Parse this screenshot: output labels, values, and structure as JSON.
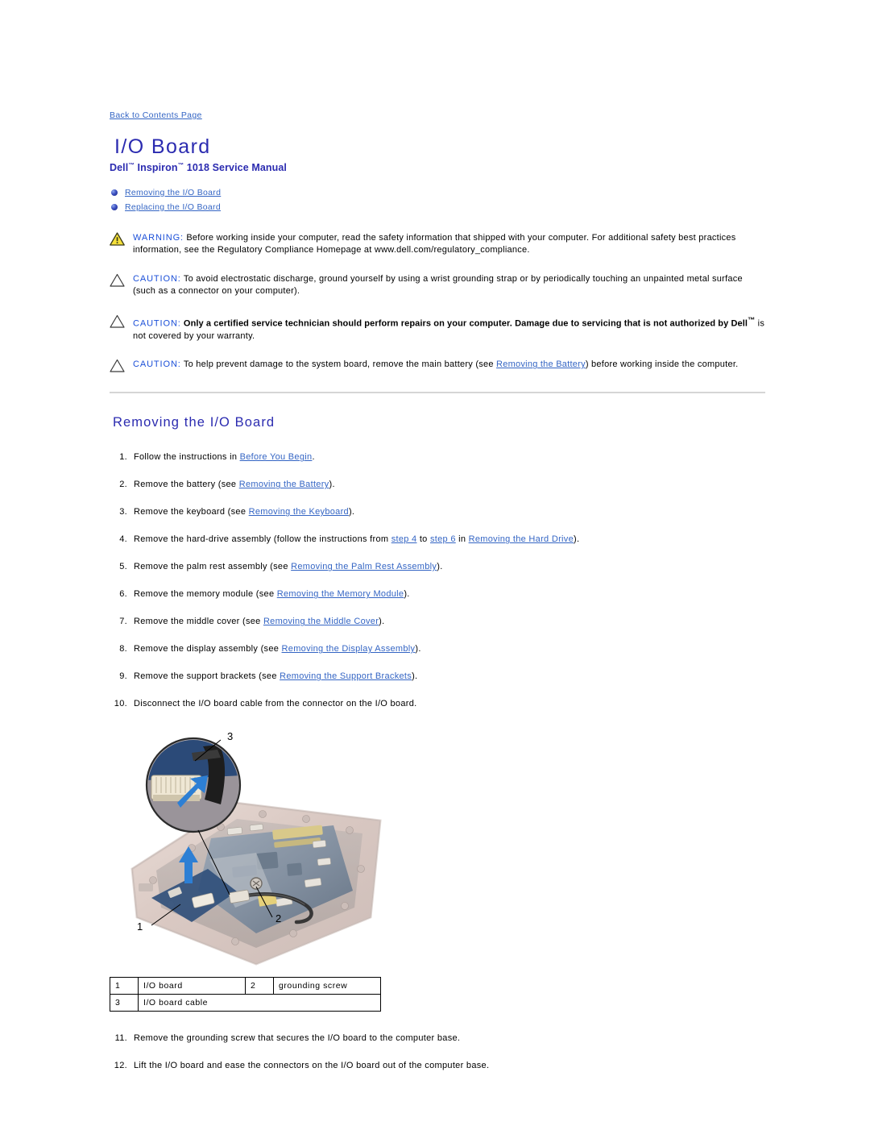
{
  "back_link": "Back to Contents Page",
  "title": "I/O Board",
  "subtitle_pre": "Dell",
  "subtitle_tm1": "™",
  "subtitle_mid": " Inspiron",
  "subtitle_tm2": "™",
  "subtitle_post": " 1018 Service Manual",
  "toc": [
    {
      "label": "Removing the I/O Board"
    },
    {
      "label": "Replacing the I/O Board"
    }
  ],
  "notes": [
    {
      "icon": "warning-triangle-icon",
      "keyword": "WARNING:",
      "text": " Before working inside your computer, read the safety information that shipped with your computer. For additional safety best practices information, see the Regulatory Compliance Homepage at www.dell.com/regulatory_compliance.",
      "bold": false
    },
    {
      "icon": "caution-triangle-icon",
      "keyword": "CAUTION:",
      "text": " To avoid electrostatic discharge, ground yourself by using a wrist grounding strap or by periodically touching an unpainted metal surface (such as a connector on your computer).",
      "bold": false
    },
    {
      "icon": "caution-triangle-icon",
      "keyword": "CAUTION:",
      "text_bold": " Only a certified service technician should perform repairs on your computer. Damage due to servicing that is not authorized by Dell",
      "text_bold_tm": "™",
      "text_tail": " is not covered by your warranty.",
      "bold": true
    },
    {
      "icon": "caution-triangle-icon",
      "keyword": "CAUTION:",
      "text_a": " To help prevent damage to the system board, remove the main battery (see ",
      "link": "Removing the Battery",
      "text_b": ") before working inside the computer.",
      "bold": false
    }
  ],
  "section_heading": "Removing the I/O Board",
  "steps": [
    {
      "num": "1.",
      "a": "Follow the instructions in ",
      "link": "Before You Begin",
      "b": "."
    },
    {
      "num": "2.",
      "a": "Remove the battery (see ",
      "link": "Removing the Battery",
      "b": ")."
    },
    {
      "num": "3.",
      "a": "Remove the keyboard (see ",
      "link": "Removing the Keyboard",
      "b": ")."
    },
    {
      "num": "4.",
      "a": "Remove the hard-drive assembly (follow the instructions from ",
      "link": "step 4",
      "mid": " to ",
      "link2": "step 6",
      "mid2": " in ",
      "link3": "Removing the Hard Drive",
      "b": ")."
    },
    {
      "num": "5.",
      "a": "Remove the palm rest assembly (see ",
      "link": "Removing the Palm Rest Assembly",
      "b": ")."
    },
    {
      "num": "6.",
      "a": "Remove the memory module (see ",
      "link": "Removing the Memory Module",
      "b": ")."
    },
    {
      "num": "7.",
      "a": "Remove the middle cover (see ",
      "link": "Removing the Middle Cover",
      "b": ")."
    },
    {
      "num": "8.",
      "a": "Remove the display assembly (see ",
      "link": "Removing the Display Assembly",
      "b": ")."
    },
    {
      "num": "9.",
      "a": "Remove the support brackets (see ",
      "link": "Removing the Support Brackets",
      "b": ")."
    },
    {
      "num": "10.",
      "a": "Disconnect the I/O board cable from the connector on the I/O board.",
      "link": "",
      "b": ""
    }
  ],
  "figure": {
    "callout_labels": [
      "1",
      "2",
      "3"
    ],
    "alt": "Photograph of laptop computer base with system board, showing I/O board, grounding screw and I/O board cable connector inset"
  },
  "callout_table": [
    {
      "idx": "1",
      "label": "I/O board",
      "idx2": "2",
      "label2": "grounding screw"
    },
    {
      "idx": "3",
      "label": "I/O board cable",
      "idx2": "",
      "label2": ""
    }
  ],
  "steps_after": [
    {
      "num": "11.",
      "text": "Remove the grounding screw that secures the I/O board to the computer base."
    },
    {
      "num": "12.",
      "text": "Lift the I/O board and ease the connectors on the I/O board out of the computer base."
    }
  ],
  "colors": {
    "heading": "#2b2bb0",
    "link": "#3465c4",
    "note_keyword": "#1b4fd8",
    "warning_fill": "#f5e03a"
  }
}
